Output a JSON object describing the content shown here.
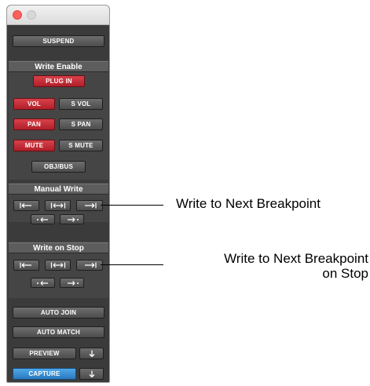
{
  "window": {
    "suspend_label": "SUSPEND",
    "write_enable": {
      "header": "Write Enable",
      "plug_in": "PLUG IN",
      "vol": "VOL",
      "s_vol": "S VOL",
      "pan": "PAN",
      "s_pan": "S PAN",
      "mute": "MUTE",
      "s_mute": "S MUTE",
      "obj_bus": "OBJ/BUS"
    },
    "manual_write": {
      "header": "Manual Write"
    },
    "write_on_stop": {
      "header": "Write on Stop"
    },
    "auto_join": "AUTO JOIN",
    "auto_match": "AUTO MATCH",
    "preview": "PREVIEW",
    "capture": "CAPTURE"
  },
  "callouts": {
    "manual_write_next": "Write to Next Breakpoint",
    "write_on_stop_next_line1": "Write to Next Breakpoint",
    "write_on_stop_next_line2": "on Stop"
  },
  "colors": {
    "panel_bg": "#3b3b3b",
    "red_active": "#c52b33",
    "blue_active": "#3a8fd6"
  }
}
